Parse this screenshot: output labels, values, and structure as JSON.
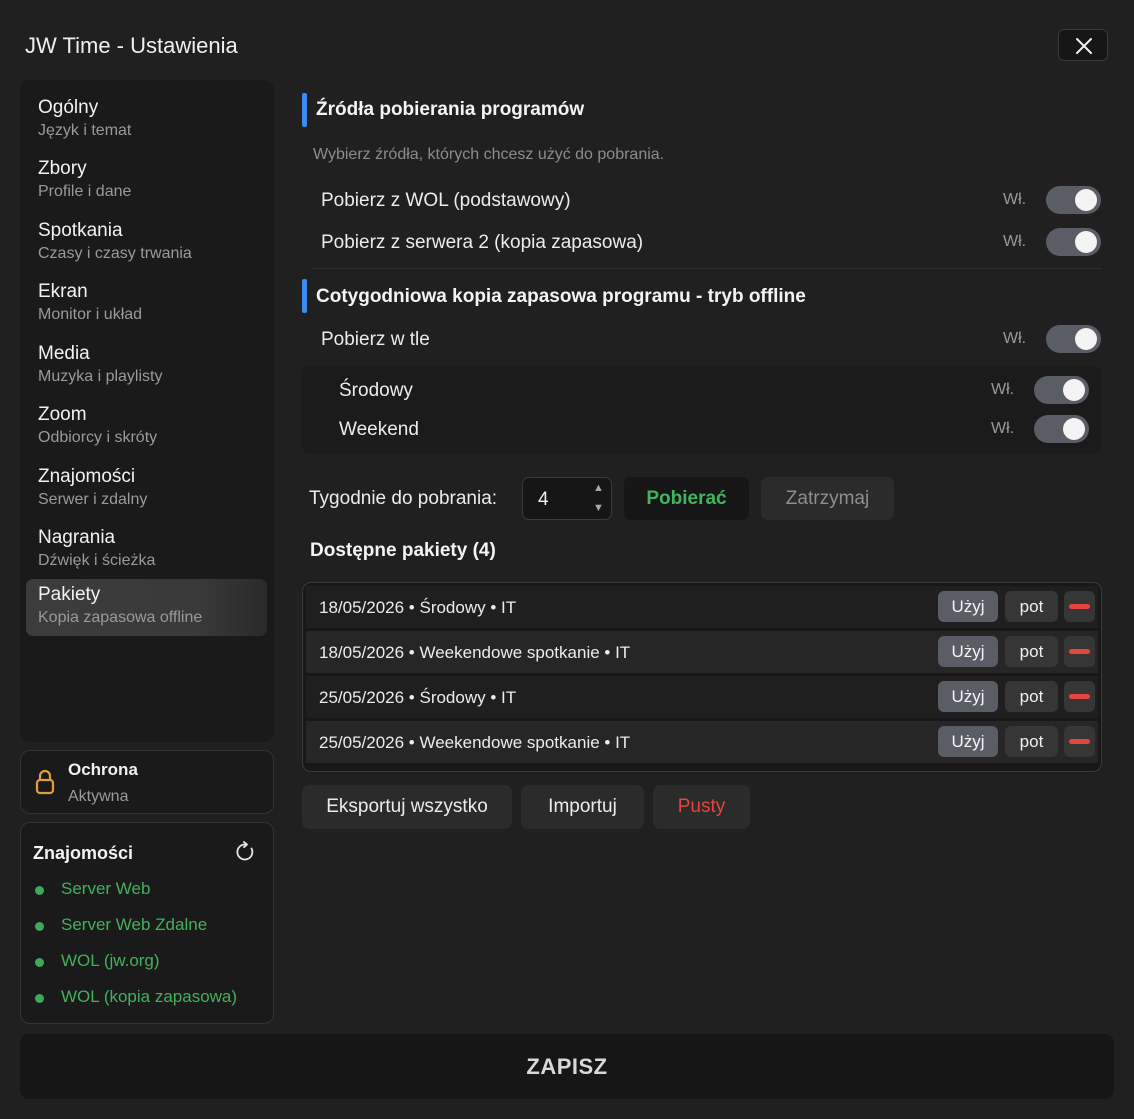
{
  "window": {
    "title": "JW Time - Ustawienia",
    "close_icon": "close-icon"
  },
  "sidebar": {
    "items": [
      {
        "label": "Ogólny",
        "sub": "Język i temat"
      },
      {
        "label": "Zbory",
        "sub": "Profile i dane"
      },
      {
        "label": "Spotkania",
        "sub": "Czasy i czasy trwania"
      },
      {
        "label": "Ekran",
        "sub": "Monitor i układ"
      },
      {
        "label": "Media",
        "sub": "Muzyka i playlisty"
      },
      {
        "label": "Zoom",
        "sub": "Odbiorcy i skróty"
      },
      {
        "label": "Znajomości",
        "sub": "Serwer i zdalny"
      },
      {
        "label": "Nagrania",
        "sub": "Dźwięk i ścieżka"
      },
      {
        "label": "Pakiety",
        "sub": "Kopia zapasowa offline"
      }
    ],
    "active_index": 8
  },
  "protection": {
    "title": "Ochrona",
    "status": "Aktywna",
    "icon": "lock-icon",
    "color": "#e0a040"
  },
  "connections": {
    "title": "Znajomości",
    "refresh_icon": "refresh-icon",
    "items": [
      "Server Web",
      "Server Web Zdalne",
      "WOL (jw.org)",
      "WOL (kopia zapasowa)"
    ],
    "status_color": "#43b05c"
  },
  "sources": {
    "title": "Źródła pobierania programów",
    "hint": "Wybierz źródła, których chcesz użyć do pobrania.",
    "rows": [
      {
        "label": "Pobierz z WOL (podstawowy)",
        "state": "Wł.",
        "on": true
      },
      {
        "label": "Pobierz z serwera 2 (kopia zapasowa)",
        "state": "Wł.",
        "on": true
      }
    ]
  },
  "weekly": {
    "title": "Cotygodniowa kopia zapasowa programu - tryb offline",
    "background": {
      "label": "Pobierz w tle",
      "state": "Wł.",
      "on": true
    },
    "sub_rows": [
      {
        "label": "Środowy",
        "state": "Wł.",
        "on": true
      },
      {
        "label": "Weekend",
        "state": "Wł.",
        "on": true
      }
    ],
    "weeks_label": "Tygodnie do pobrania:",
    "weeks_value": "4",
    "download_label": "Pobierać",
    "stop_label": "Zatrzymaj"
  },
  "packages": {
    "title": "Dostępne pakiety (4)",
    "use_label": "Użyj",
    "pot_label": "pot",
    "rows": [
      "18/05/2026 • Środowy • IT",
      "18/05/2026 • Weekendowe spotkanie • IT",
      "25/05/2026 • Środowy • IT",
      "25/05/2026 • Weekendowe spotkanie • IT"
    ],
    "export_label": "Eksportuj wszystko",
    "import_label": "Importuj",
    "empty_label": "Pusty"
  },
  "footer": {
    "save_label": "ZAPISZ"
  },
  "colors": {
    "accent": "#3d8bf0",
    "success": "#3fb55e",
    "danger": "#e5453e",
    "toggle_on": "#5b5d66"
  }
}
